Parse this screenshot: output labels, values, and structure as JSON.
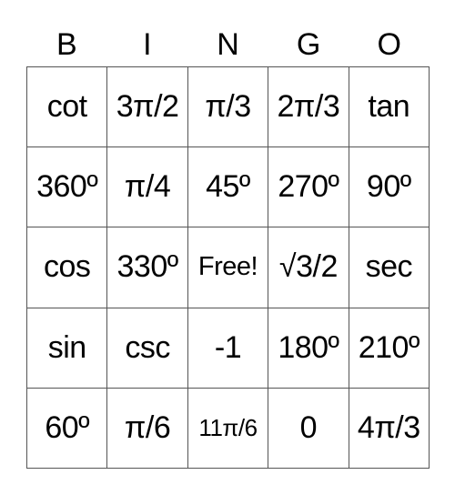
{
  "header": [
    "B",
    "I",
    "N",
    "G",
    "O"
  ],
  "rows": [
    [
      "cot",
      "3π/2",
      "π/3",
      "2π/3",
      "tan"
    ],
    [
      "360º",
      "π/4",
      "45º",
      "270º",
      "90º"
    ],
    [
      "cos",
      "330º",
      "Free!",
      "√3/2",
      "sec"
    ],
    [
      "sin",
      "csc",
      "-1",
      "180º",
      "210º"
    ],
    [
      "60º",
      "π/6",
      "11π/6",
      "0",
      "4π/3"
    ]
  ]
}
